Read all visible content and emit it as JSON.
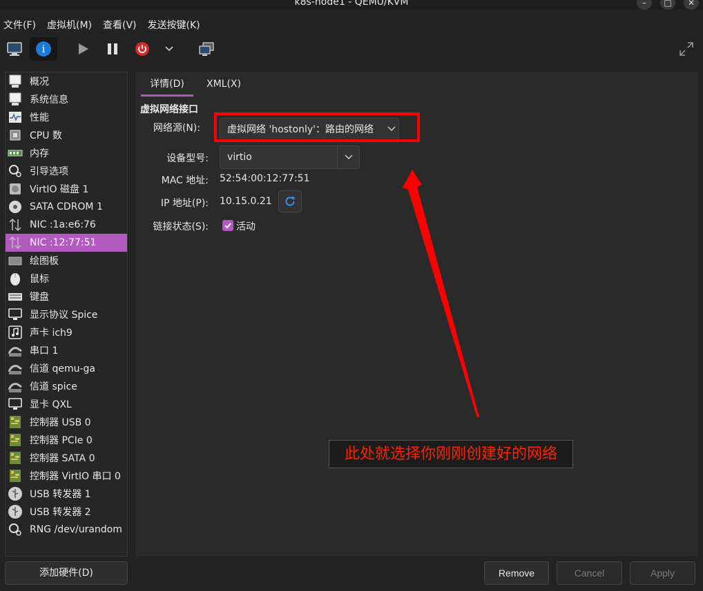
{
  "window": {
    "title": "k8s-node1 - QEMU/KVM",
    "minimize_glyph": "–",
    "maximize_glyph": "□",
    "close_glyph": "✕"
  },
  "menubar": {
    "items": [
      "文件(F)",
      "虚拟机(M)",
      "查看(V)",
      "发送按键(K)"
    ]
  },
  "toolbar": {
    "icons": [
      "monitor-icon",
      "info-icon",
      "play-icon",
      "pause-icon",
      "power-icon",
      "chevron-down-icon",
      "screenshot-icon",
      "fullscreen-icon"
    ],
    "info_glyph": "i",
    "chevron_glyph": "⌄",
    "accent": "#1e7ad4",
    "power_color": "#d42a2a"
  },
  "sidebar": {
    "items": [
      {
        "label": "概况",
        "icon": "overview-icon"
      },
      {
        "label": "系统信息",
        "icon": "system-info-icon"
      },
      {
        "label": "性能",
        "icon": "performance-icon"
      },
      {
        "label": "CPU 数",
        "icon": "cpu-icon"
      },
      {
        "label": "内存",
        "icon": "memory-icon"
      },
      {
        "label": "引导选项",
        "icon": "boot-options-icon"
      },
      {
        "label": "VirtIO 磁盘 1",
        "icon": "disk-icon"
      },
      {
        "label": "SATA CDROM 1",
        "icon": "cdrom-icon"
      },
      {
        "label": "NIC :1a:e6:76",
        "icon": "nic-icon"
      },
      {
        "label": "NIC :12:77:51",
        "icon": "nic-icon",
        "selected": true
      },
      {
        "label": "绘图板",
        "icon": "tablet-icon"
      },
      {
        "label": "鼠标",
        "icon": "mouse-icon"
      },
      {
        "label": "键盘",
        "icon": "keyboard-icon"
      },
      {
        "label": "显示协议 Spice",
        "icon": "display-icon"
      },
      {
        "label": "声卡 ich9",
        "icon": "sound-icon"
      },
      {
        "label": "串口 1",
        "icon": "serial-icon"
      },
      {
        "label": "信道 qemu-ga",
        "icon": "channel-icon"
      },
      {
        "label": "信道 spice",
        "icon": "channel-icon"
      },
      {
        "label": "显卡 QXL",
        "icon": "video-icon"
      },
      {
        "label": "控制器 USB 0",
        "icon": "controller-icon"
      },
      {
        "label": "控制器 PCIe 0",
        "icon": "controller-icon"
      },
      {
        "label": "控制器 SATA 0",
        "icon": "controller-icon"
      },
      {
        "label": "控制器 VirtIO 串口 0",
        "icon": "controller-icon"
      },
      {
        "label": "USB 转发器 1",
        "icon": "usb-redirector-icon"
      },
      {
        "label": "USB 转发器 2",
        "icon": "usb-redirector-icon"
      },
      {
        "label": "RNG /dev/urandom",
        "icon": "rng-icon"
      }
    ],
    "selected_color": "#b35ac0",
    "add_hardware_label": "添加硬件(D)"
  },
  "tabs": [
    {
      "label": "详情(D)",
      "active": true
    },
    {
      "label": "XML(X)",
      "active": false
    }
  ],
  "details": {
    "section_title": "虚拟网络接口",
    "network_source_label": "网络源(N):",
    "network_source_value": "虚拟网络 'hostonly'：路由的网络",
    "device_model_label": "设备型号:",
    "device_model_value": "virtio",
    "mac_label": "MAC 地址:",
    "mac_value": "52:54:00:12:77:51",
    "ip_label": "IP 地址(P):",
    "ip_value": "10.15.0.21",
    "link_state_label": "链接状态(S):",
    "link_state_value": "活动",
    "link_state_checked": true
  },
  "annotation": {
    "text": "此处就选择你刚刚创建好的网络",
    "color": "#ff2200"
  },
  "buttons": {
    "remove": "Remove",
    "cancel": "Cancel",
    "apply": "Apply"
  }
}
